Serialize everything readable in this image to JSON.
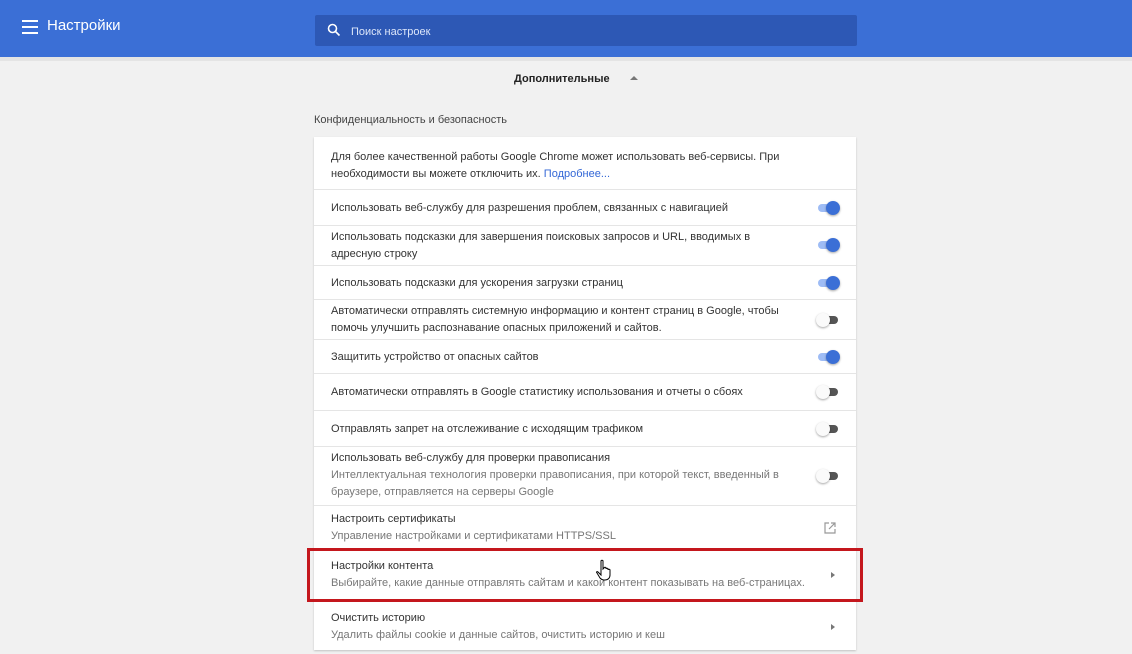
{
  "header": {
    "title": "Настройки",
    "search_placeholder": "Поиск настроек"
  },
  "advanced": {
    "label": "Дополнительные"
  },
  "section": {
    "title": "Конфиденциальность и безопасность"
  },
  "intro": {
    "text": "Для более качественной работы Google Chrome может использовать веб-сервисы. При необходимости вы можете отключить их.",
    "link": "Подробнее..."
  },
  "settings": [
    {
      "label": "Использовать веб-службу для разрешения проблем, связанных с навигацией",
      "enabled": true
    },
    {
      "label": "Использовать подсказки для завершения поисковых запросов и URL, вводимых в адресную строку",
      "enabled": true
    },
    {
      "label": "Использовать подсказки для ускорения загрузки страниц",
      "enabled": true
    },
    {
      "label": "Автоматически отправлять системную информацию и контент страниц в Google, чтобы помочь улучшить распознавание опасных приложений и сайтов.",
      "enabled": false
    },
    {
      "label": "Защитить устройство от опасных сайтов",
      "enabled": true
    },
    {
      "label": "Автоматически отправлять в Google статистику использования и отчеты о сбоях",
      "enabled": false
    },
    {
      "label": "Отправлять запрет на отслеживание с исходящим трафиком",
      "enabled": false
    },
    {
      "label": "Использовать веб-службу для проверки правописания",
      "description": "Интеллектуальная технология проверки правописания, при которой текст, введенный в браузере, отправляется на серверы Google",
      "enabled": false
    }
  ],
  "links": [
    {
      "title": "Настроить сертификаты",
      "description": "Управление настройками и сертификатами HTTPS/SSL",
      "icon": "external-link-icon"
    },
    {
      "title": "Настройки контента",
      "description": "Выбирайте, какие данные отправлять сайтам и какой контент показывать на веб-страницах.",
      "icon": "chevron-right-icon"
    },
    {
      "title": "Очистить историю",
      "description": "Удалить файлы cookie и данные сайтов, очистить историю и кеш",
      "icon": "chevron-right-icon"
    }
  ],
  "colors": {
    "header": "#3b6fd6",
    "accent": "#3b6fd6",
    "highlight_border": "#c4171d"
  }
}
